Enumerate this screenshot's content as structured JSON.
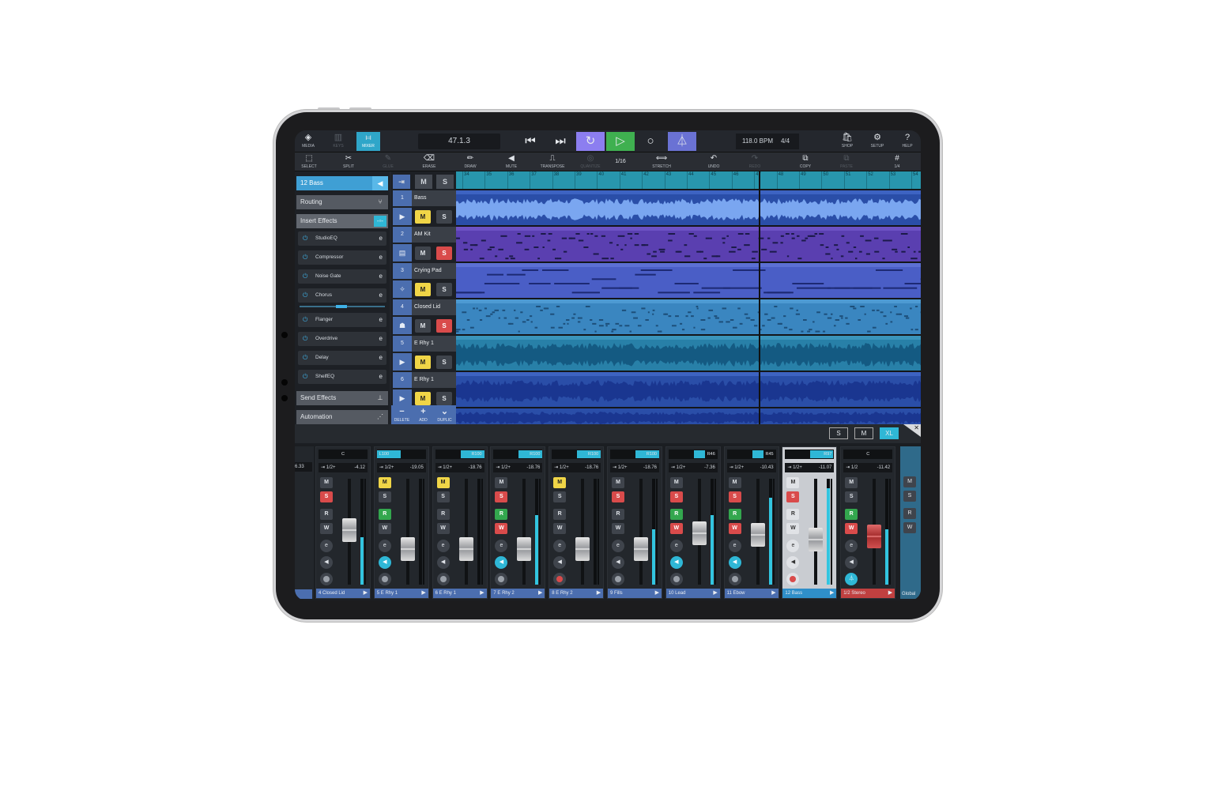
{
  "transport": {
    "position": "47.1.3",
    "tempo": "118.0 BPM",
    "signature": "4/4"
  },
  "topbar": {
    "left": [
      {
        "label": "MEDIA",
        "icon": "media-icon"
      },
      {
        "label": "KEYS",
        "icon": "keys-icon"
      },
      {
        "label": "MIXER",
        "icon": "mixer-icon"
      }
    ],
    "right": [
      {
        "label": "SHOP",
        "icon": "shop-icon"
      },
      {
        "label": "SETUP",
        "icon": "gear-icon"
      },
      {
        "label": "HELP",
        "icon": "help-icon"
      }
    ]
  },
  "toolbar": {
    "tools": [
      "SELECT",
      "SPLIT",
      "GLUE",
      "ERASE",
      "DRAW",
      "MUTE",
      "TRANSPOSE",
      "QUANTIZE",
      "STRETCH",
      "UNDO",
      "REDO",
      "COPY",
      "PASTE"
    ],
    "quantize_value": "1/16",
    "grid_value": "1/4"
  },
  "inspector": {
    "track_title": "12  Bass",
    "sections": {
      "routing": "Routing",
      "insert": "Insert Effects",
      "send": "Send Effects",
      "automation": "Automation"
    },
    "effects": [
      "StudioEQ",
      "Compressor",
      "Noise Gate",
      "Chorus",
      "Flanger",
      "Overdrive",
      "Delay",
      "ShelfEQ"
    ]
  },
  "tracklist": {
    "header": [
      "M",
      "S"
    ],
    "tracks": [
      {
        "num": "1",
        "name": "Bass",
        "m": "M",
        "s": "S"
      },
      {
        "num": "2",
        "name": "AM Kit",
        "m": "M",
        "s": "S"
      },
      {
        "num": "3",
        "name": "Crying Pad",
        "m": "M",
        "s": "S"
      },
      {
        "num": "4",
        "name": "Closed Lid",
        "m": "M",
        "s": "S"
      },
      {
        "num": "5",
        "name": "E Rhy 1",
        "m": "M",
        "s": "S"
      },
      {
        "num": "6",
        "name": "E Rhy 1",
        "m": "M",
        "s": "S"
      }
    ],
    "footer": [
      "DELETE",
      "ADD",
      "DUPLIC"
    ]
  },
  "ruler": {
    "bars": [
      "34",
      "35",
      "36",
      "37",
      "38",
      "39",
      "40",
      "41",
      "42",
      "43",
      "44",
      "45",
      "46",
      "47",
      "48",
      "49",
      "50",
      "51",
      "52",
      "53",
      "54"
    ]
  },
  "mixer": {
    "view_buttons": [
      "S",
      "M",
      "XL"
    ],
    "strips": [
      {
        "pan": "C",
        "io": "1/2+",
        "db": "-4.12",
        "name": "4   Closed Lid"
      },
      {
        "pan": "L100",
        "io": "1/2+",
        "db": "-19.05",
        "name": "5   E Rhy 1"
      },
      {
        "pan": "R100",
        "io": "1/2+",
        "db": "-18.76",
        "name": "6   E Rhy 1"
      },
      {
        "pan": "R100",
        "io": "1/2+",
        "db": "-18.76",
        "name": "7   E Rhy 2"
      },
      {
        "pan": "R100",
        "io": "1/2+",
        "db": "-18.76",
        "name": "8   E Rhy 2"
      },
      {
        "pan": "R100",
        "io": "1/2+",
        "db": "-18.76",
        "name": "9   Fills"
      },
      {
        "pan": "R46",
        "io": "1/2+",
        "db": "-7.36",
        "name": "10   Lead"
      },
      {
        "pan": "R45",
        "io": "1/2+",
        "db": "-10.43",
        "name": "11   Ebow"
      },
      {
        "pan": "R97",
        "io": "1/2+",
        "db": "-11.07",
        "name": "12   Bass"
      },
      {
        "pan": "C",
        "io": "1/2",
        "db": "-11.42",
        "name": "1/2   Stereo"
      }
    ],
    "partial_left_db": "6.33",
    "global_label": "Global",
    "buttons": {
      "m": "M",
      "s": "S",
      "r": "R",
      "w": "W"
    },
    "colors": {
      "accent": "#2fb7d6",
      "mute": "#f0d547",
      "solo": "#d94b4b",
      "read": "#33a74e",
      "track": "#4b6eaf"
    }
  }
}
